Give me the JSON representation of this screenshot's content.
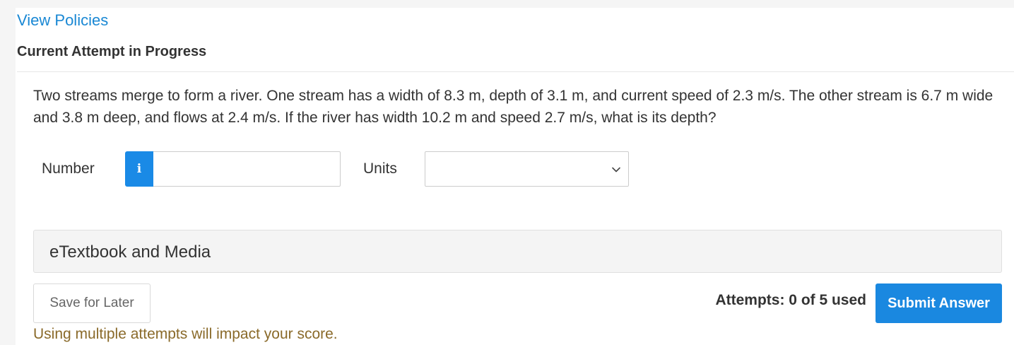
{
  "header": {
    "policies_link": "View Policies",
    "attempt_heading": "Current Attempt in Progress"
  },
  "question": {
    "text": "Two streams merge to form a river. One stream has a width of 8.3 m, depth of 3.1 m, and current speed of 2.3 m/s. The other stream is 6.7 m wide and 3.8 m deep, and flows at 2.4 m/s. If the river has width 10.2 m and speed 2.7 m/s, what is its depth?"
  },
  "answer": {
    "number_label": "Number",
    "info_icon_glyph": "i",
    "number_value": "",
    "units_label": "Units",
    "units_selected": ""
  },
  "resources": {
    "panel_title": "eTextbook and Media"
  },
  "footer": {
    "save_label": "Save for Later",
    "attempts_text": "Attempts: 0 of 5 used",
    "submit_label": "Submit Answer",
    "warning": "Using multiple attempts will impact your score."
  },
  "colors": {
    "link": "#1a88d4",
    "primary_button": "#1a88e0",
    "info_button": "#1a8ae6",
    "warning_text": "#8a6a2a",
    "panel_background": "#f4f4f4"
  },
  "icons": {
    "info": "info-icon",
    "dropdown": "chevron-down-icon"
  }
}
